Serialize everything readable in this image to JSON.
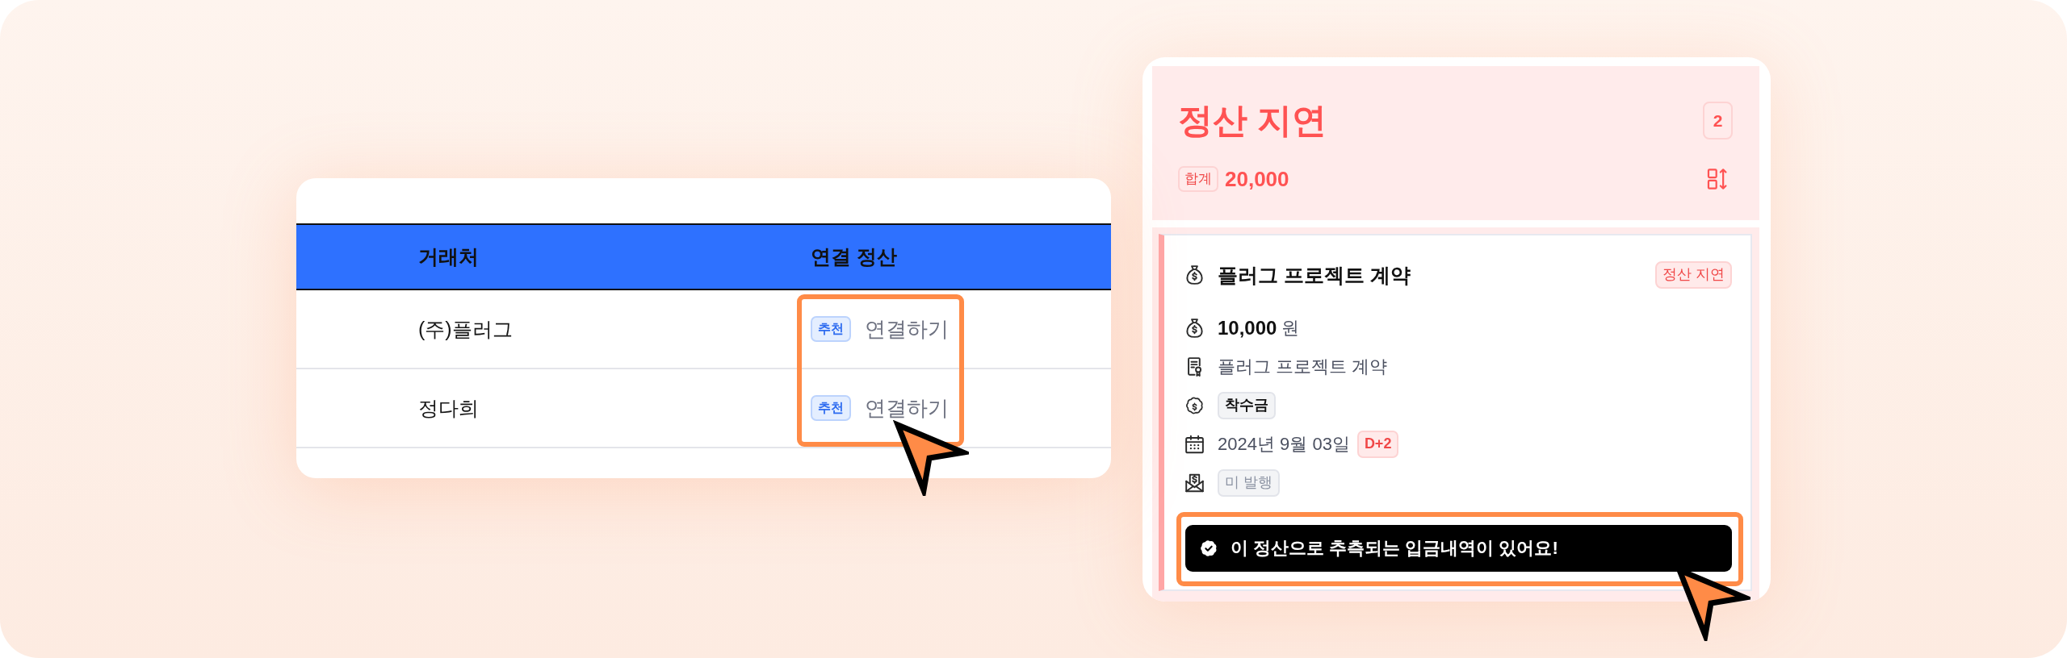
{
  "table": {
    "columns": [
      "거래처",
      "연결 정산"
    ],
    "rows": [
      {
        "partner": "(주)플러그",
        "tag": "추천",
        "action": "연결하기"
      },
      {
        "partner": "정다희",
        "tag": "추천",
        "action": "연결하기"
      }
    ]
  },
  "board": {
    "title": "정산 지연",
    "count": "2",
    "total_label": "합계",
    "total": "20,000",
    "card": {
      "title": "플러그 프로젝트 계약",
      "status": "정산 지연",
      "details": [
        {
          "kind": "amount",
          "value": "10,000",
          "unit": "원"
        },
        {
          "kind": "contract",
          "value": "플러그 프로젝트 계약"
        },
        {
          "kind": "stage",
          "value": "착수금"
        },
        {
          "kind": "date",
          "value": "2024년 9월 03일",
          "tag": "D+2"
        },
        {
          "kind": "invoice",
          "value": "미 발행"
        }
      ],
      "notice": "이 정산으로 추측되는 입금내역이 있어요!"
    }
  }
}
